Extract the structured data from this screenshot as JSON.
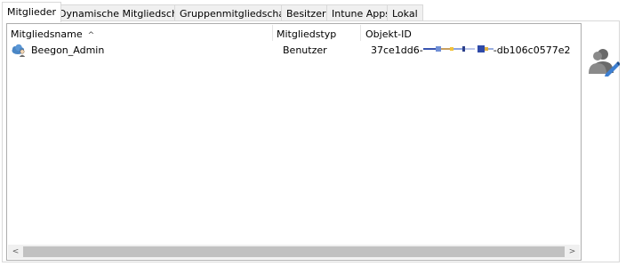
{
  "tabs": [
    {
      "label": "Mitglieder",
      "active": true
    },
    {
      "label": "Dynamische Mitgliedschaft",
      "active": false
    },
    {
      "label": "Gruppenmitgliedschaft",
      "active": false
    },
    {
      "label": "Besitzer",
      "active": false
    },
    {
      "label": "Intune Apps",
      "active": false
    },
    {
      "label": "Lokal",
      "active": false
    }
  ],
  "table": {
    "columns": [
      "Mitgliedsname",
      "Mitgliedstyp",
      "Objekt-ID"
    ],
    "sort_indicator": "^",
    "rows": [
      {
        "icon": "cloud-user-icon",
        "name": "Beegon_Admin",
        "type": "Benutzer",
        "object_id_prefix": "37ce1dd6-",
        "object_id_suffix": "-db106c0577e2"
      }
    ]
  },
  "scrollbar": {
    "left_arrow": "<",
    "right_arrow": ">"
  },
  "side_icon": "edit-members-icon"
}
